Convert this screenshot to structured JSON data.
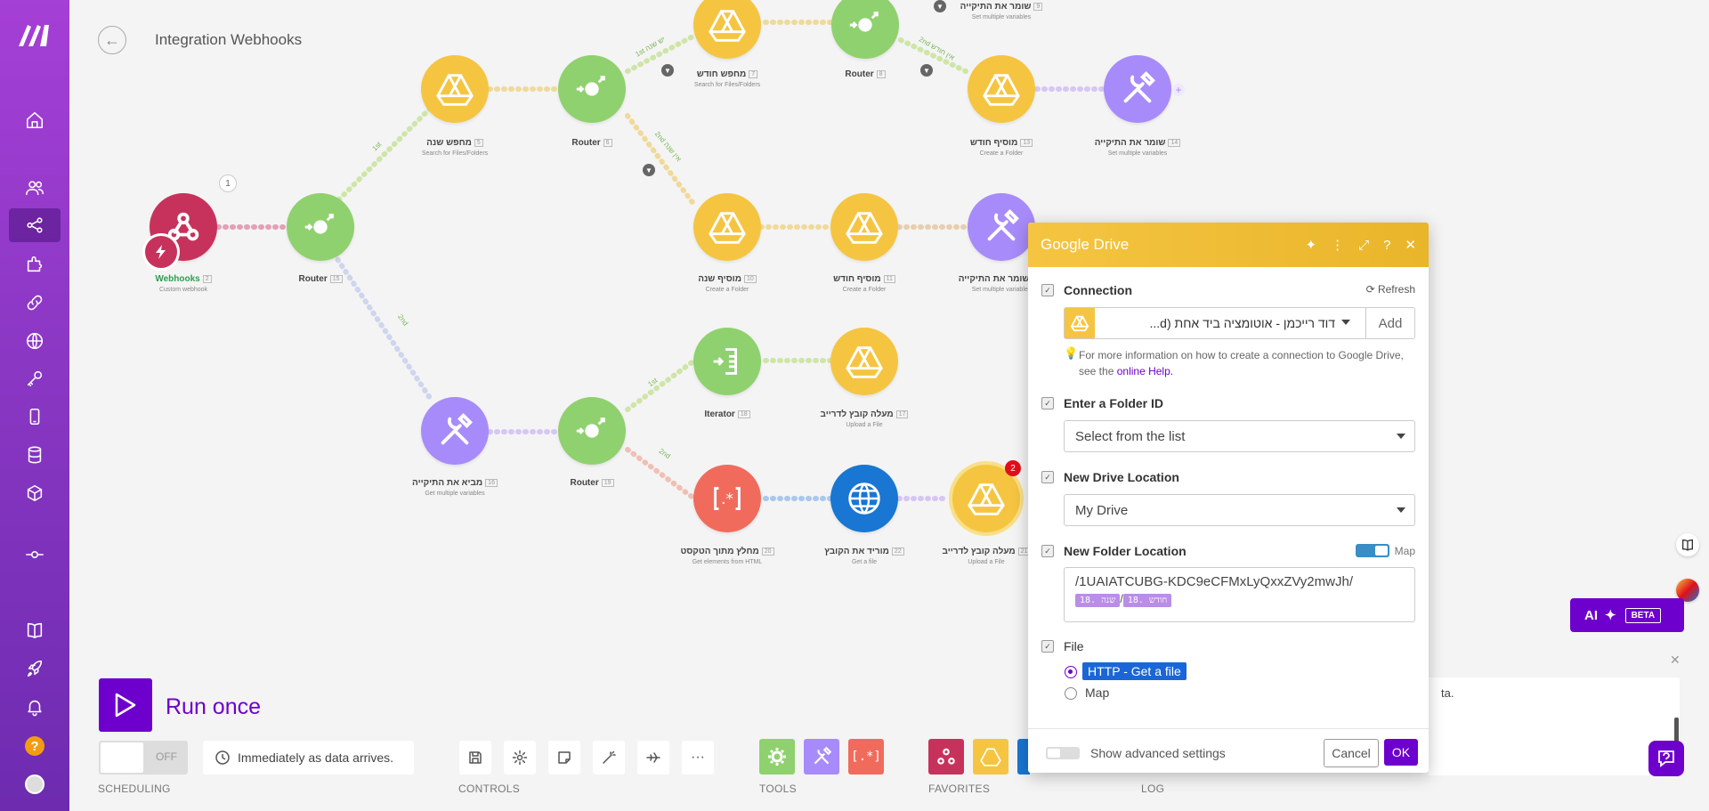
{
  "scenario": {
    "title": "Integration Webhooks",
    "back_icon": "arrow-left-icon"
  },
  "colors": {
    "brand": "#6d00cc",
    "sidebar": "#8a37c4",
    "drive": "#f5c542",
    "router": "#8fd16e",
    "tools": "#a78bfa",
    "webhook": "#c7325c",
    "http": "#1976d2",
    "text_parser": "#f16b5c"
  },
  "sidebar": {
    "items": [
      {
        "name": "home-icon"
      },
      {
        "name": "team-icon"
      },
      {
        "name": "scenarios-icon",
        "active": true
      },
      {
        "name": "templates-icon"
      },
      {
        "name": "connections-icon"
      },
      {
        "name": "webhooks-icon"
      },
      {
        "name": "keys-icon"
      },
      {
        "name": "devices-icon"
      },
      {
        "name": "datastores-icon"
      },
      {
        "name": "datastructures-icon"
      },
      {
        "name": "flow-icon"
      },
      {
        "name": "docs-icon"
      },
      {
        "name": "rocket-icon"
      },
      {
        "name": "bell-icon"
      }
    ],
    "help": "?"
  },
  "modules": [
    {
      "id": "webhook",
      "label": "Webhooks",
      "num": "2",
      "sub": "Custom webhook"
    },
    {
      "id": "router1",
      "label": "Router",
      "num": "15",
      "sub": ""
    },
    {
      "id": "search_year",
      "label": "מחפש שנה",
      "num": "5",
      "sub": "Search for Files/Folders"
    },
    {
      "id": "router2",
      "label": "Router",
      "num": "6",
      "sub": ""
    },
    {
      "id": "search_month",
      "label": "מחפש חודש",
      "num": "7",
      "sub": "Search for Files/Folders"
    },
    {
      "id": "router3",
      "label": "Router",
      "num": "8",
      "sub": ""
    },
    {
      "id": "saves_top",
      "label": "שומר את התיקייה",
      "num": "9",
      "sub": "Set multiple variables"
    },
    {
      "id": "add_month_top",
      "label": "מוסיף חודש",
      "num": "13",
      "sub": "Create a Folder"
    },
    {
      "id": "saves_far",
      "label": "שומר את התיקייה",
      "num": "14",
      "sub": "Set multiple variables"
    },
    {
      "id": "add_year",
      "label": "מוסיף שנה",
      "num": "10",
      "sub": "Create a Folder"
    },
    {
      "id": "add_month_mid",
      "label": "מוסיף חודש",
      "num": "11",
      "sub": "Create a Folder"
    },
    {
      "id": "saves_mid",
      "label": "שומר את התיקייה",
      "num": "12",
      "sub": "Set multiple variables"
    },
    {
      "id": "brings",
      "label": "מביא את התיקייה",
      "num": "16",
      "sub": "Get multiple variables"
    },
    {
      "id": "router4",
      "label": "Router",
      "num": "19",
      "sub": ""
    },
    {
      "id": "iterator",
      "label": "Iterator",
      "num": "18",
      "sub": ""
    },
    {
      "id": "upload1",
      "label": "מעלה קובץ לדרייב",
      "num": "17",
      "sub": "Upload a File"
    },
    {
      "id": "extract",
      "label": "מחלץ מתוך הטקסט",
      "num": "20",
      "sub": "Get elements from HTML"
    },
    {
      "id": "download",
      "label": "מוריד את הקובץ",
      "num": "22",
      "sub": "Get a file"
    },
    {
      "id": "upload2",
      "label": "מעלה קובץ לדרייב",
      "num": "21",
      "sub": "Upload a File"
    }
  ],
  "route_labels": {
    "r1a": "1st",
    "r1b": "2nd",
    "r2a": "1st יש שנה",
    "r2b": "2nd אין שנה",
    "r3b": "2nd אין חודש",
    "r4a": "1st",
    "r4b": "2nd"
  },
  "badges": {
    "webhook": "1",
    "upload2": "2"
  },
  "runbar": {
    "run_label": "Run once",
    "toggle": "OFF",
    "schedule": "Immediately as data arrives.",
    "scheduling_label": "SCHEDULING",
    "controls_label": "CONTROLS",
    "tools_label": "TOOLS",
    "favorites_label": "FAVORITES",
    "log_label": "LOG"
  },
  "ai_button": {
    "label": "AI",
    "beta": "BETA"
  },
  "log_text": "ta.",
  "dialog": {
    "title": "Google Drive",
    "connection": {
      "label": "Connection",
      "refresh": "Refresh",
      "value": "דוד רייכמן - אוטומציה ביד אחת (d...",
      "add": "Add",
      "hint": "For more information on how to create a connection to Google Drive, see the",
      "hint_link": "online Help."
    },
    "folder_id": {
      "label": "Enter a Folder ID",
      "value": "Select from the list"
    },
    "drive_location": {
      "label": "New Drive Location",
      "value": "My Drive"
    },
    "folder_location": {
      "label": "New Folder Location",
      "map": "Map",
      "value": "/1UAIATCUBG-KDC9eCFMxLyQxxZVy2mwJh/",
      "pill1": "18. שנה",
      "slash": "/",
      "pill2": "18. חודש"
    },
    "file": {
      "label": "File",
      "opt1": "HTTP - Get a file",
      "opt2": "Map"
    },
    "advanced": "Show advanced settings",
    "cancel": "Cancel",
    "ok": "OK"
  }
}
